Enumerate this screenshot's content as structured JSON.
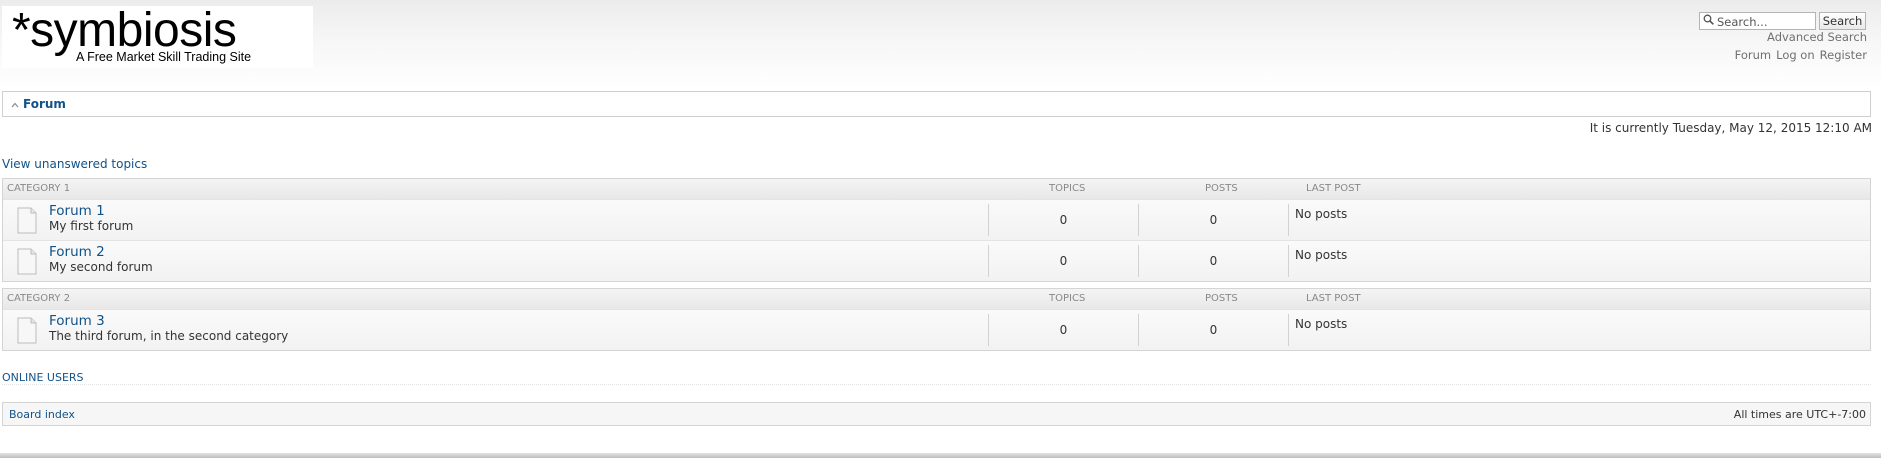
{
  "header": {
    "logo_title": "*symbiosis",
    "logo_tagline": "A Free Market Skill Trading Site",
    "search_placeholder": "Search...",
    "search_button": "Search",
    "advanced_search": "Advanced Search",
    "links": [
      "Forum",
      "Log on",
      "Register"
    ]
  },
  "nav": {
    "breadcrumb": "Forum"
  },
  "current_time": "It is currently Tuesday, May 12, 2015 12:10 AM",
  "unanswered_link": "View unanswered topics",
  "columns": {
    "topics": "TOPICS",
    "posts": "POSTS",
    "last_post": "LAST POST"
  },
  "categories": [
    {
      "name": "CATEGORY 1",
      "forums": [
        {
          "title": "Forum 1",
          "description": "My first forum",
          "topics": "0",
          "posts": "0",
          "last_post": "No posts"
        },
        {
          "title": "Forum 2",
          "description": "My second forum",
          "topics": "0",
          "posts": "0",
          "last_post": "No posts"
        }
      ]
    },
    {
      "name": "CATEGORY 2",
      "forums": [
        {
          "title": "Forum 3",
          "description": "The third forum, in the second category",
          "topics": "0",
          "posts": "0",
          "last_post": "No posts"
        }
      ]
    }
  ],
  "online_users": "ONLINE USERS",
  "footer": {
    "board_index": "Board index",
    "timezone": "All times are UTC+-7:00"
  },
  "colors": {
    "link": "#105289",
    "text": "#333333",
    "muted": "#707070"
  },
  "icons": {
    "search": "magnifier-icon",
    "nav": "chevron-up-icon",
    "forum_read": "forum-read-icon"
  }
}
